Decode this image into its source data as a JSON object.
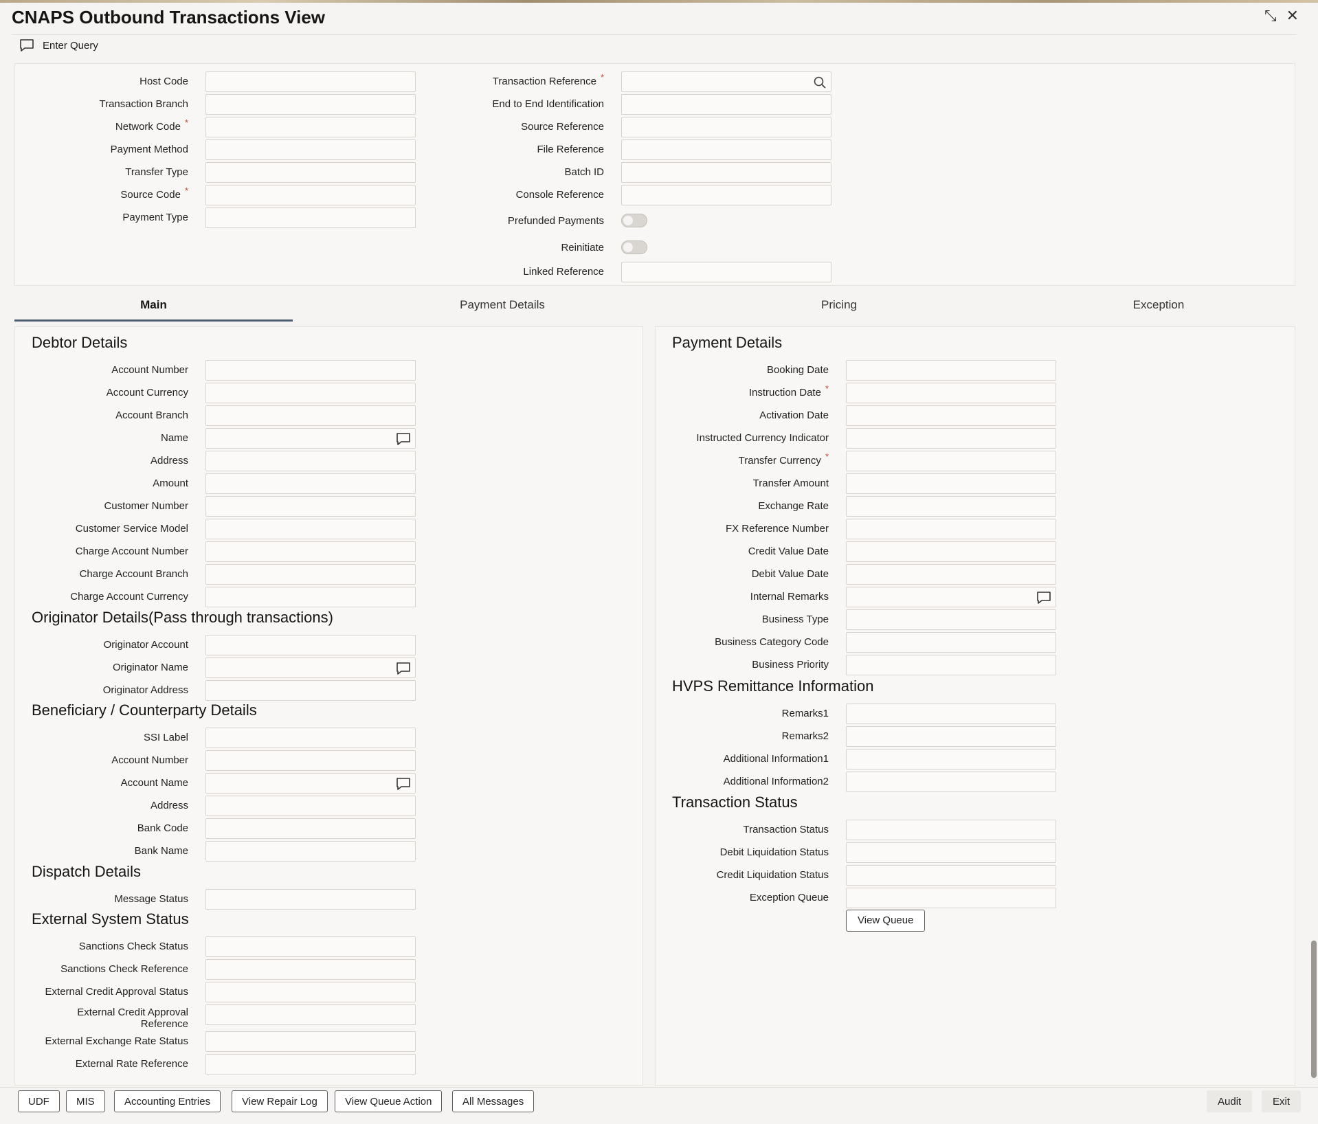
{
  "window": {
    "title": "CNAPS Outbound Transactions View",
    "restore_icon": "⤡",
    "close_icon": "✕"
  },
  "toolbar": {
    "enter_query": "Enter Query"
  },
  "required_marker": "*",
  "header": {
    "left_fields": [
      {
        "label": "Host Code",
        "required": false
      },
      {
        "label": "Transaction Branch",
        "required": false
      },
      {
        "label": "Network Code",
        "required": true
      },
      {
        "label": "Payment Method",
        "required": false
      },
      {
        "label": "Transfer Type",
        "required": false
      },
      {
        "label": "Source Code",
        "required": true
      },
      {
        "label": "Payment Type",
        "required": false
      }
    ],
    "right_fields": [
      {
        "label": "Transaction Reference",
        "required": true,
        "icon": "search-icon"
      },
      {
        "label": "End to End Identification"
      },
      {
        "label": "Source Reference"
      },
      {
        "label": "File Reference"
      },
      {
        "label": "Batch ID"
      },
      {
        "label": "Console Reference"
      }
    ],
    "toggles": [
      {
        "label": "Prefunded Payments",
        "on": false
      },
      {
        "label": "Reinitiate",
        "on": false
      }
    ],
    "linked_reference": "Linked Reference"
  },
  "tabs": [
    "Main",
    "Payment Details",
    "Pricing",
    "Exception"
  ],
  "active_tab": "Main",
  "left_panel": {
    "debtor": {
      "title": "Debtor Details",
      "fields": [
        "Account Number",
        "Account Currency",
        "Account Branch",
        "Name",
        "Address",
        "Amount",
        "Customer Number",
        "Customer Service Model",
        "Charge Account Number",
        "Charge Account Branch",
        "Charge Account Currency"
      ]
    },
    "originator": {
      "title": "Originator Details(Pass through transactions)",
      "fields": [
        "Originator Account",
        "Originator Name",
        "Originator Address"
      ]
    },
    "beneficiary": {
      "title": "Beneficiary / Counterparty Details",
      "fields": [
        "SSI Label",
        "Account Number",
        "Account Name",
        "Address",
        "Bank Code",
        "Bank Name"
      ]
    },
    "dispatch": {
      "title": "Dispatch Details",
      "fields": [
        "Message Status"
      ]
    },
    "external": {
      "title": "External System Status",
      "fields": [
        "Sanctions Check Status",
        "Sanctions Check Reference",
        "External Credit Approval Status",
        "External Credit Approval",
        "Reference",
        "External Exchange Rate Status",
        "External Rate Reference"
      ]
    }
  },
  "right_panel": {
    "payment": {
      "title": "Payment Details",
      "fields": [
        "Booking Date",
        "Instruction Date",
        "Activation Date",
        "Instructed Currency Indicator",
        "Transfer Currency",
        "Transfer Amount",
        "Exchange Rate",
        "FX Reference Number",
        "Credit Value Date",
        "Debit Value Date",
        "Internal Remarks",
        "Business Type",
        "Business Category Code",
        "Business Priority"
      ]
    },
    "hvps": {
      "title": "HVPS Remittance Information",
      "fields": [
        "Remarks1",
        "Remarks2",
        "Additional Information1",
        "Additional Information2"
      ]
    },
    "status": {
      "title": "Transaction Status",
      "fields": [
        "Transaction Status",
        "Debit Liquidation Status",
        "Credit Liquidation Status",
        "Exception Queue"
      ],
      "view_queue": "View Queue"
    }
  },
  "footer": {
    "buttons": [
      "UDF",
      "MIS",
      "Accounting Entries",
      "View Repair Log",
      "View Queue Action",
      "All Messages"
    ],
    "audit": "Audit",
    "exit": "Exit"
  }
}
